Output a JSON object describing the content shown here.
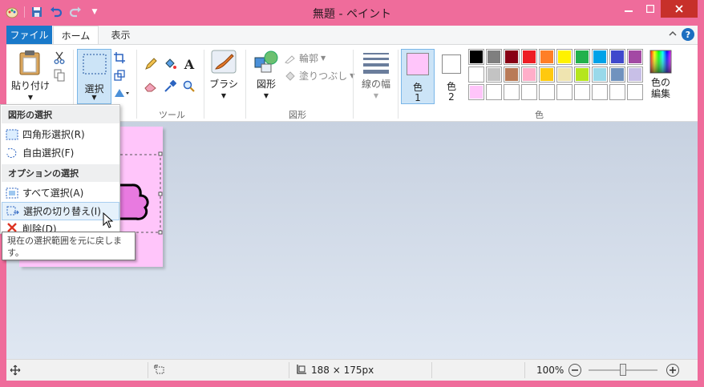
{
  "window": {
    "title": "無題 - ペイント"
  },
  "tabs": {
    "file": "ファイル",
    "home": "ホーム",
    "view": "表示"
  },
  "ribbon": {
    "clipboard": {
      "paste_label": "貼り付け"
    },
    "image": {
      "select_label": "選択"
    },
    "tools": {
      "group_label": "ツール"
    },
    "brushes": {
      "label": "ブラシ"
    },
    "shapes": {
      "shapes_label": "図形",
      "outline_label": "輪郭",
      "fill_label": "塗りつぶし",
      "group_label": "図形"
    },
    "size": {
      "label": "線の幅"
    },
    "colors": {
      "color1_label": "色",
      "color1_num": "1",
      "color2_label": "色",
      "color2_num": "2",
      "edit_label_1": "色の",
      "edit_label_2": "編集",
      "group_label": "色",
      "color1": "#ffc5fa",
      "color2": "#ffffff",
      "palette_row1": [
        "#000000",
        "#7f7f7f",
        "#880015",
        "#ed1c24",
        "#ff7f27",
        "#fff200",
        "#22b14c",
        "#00a2e8",
        "#3f48cc",
        "#a349a4"
      ],
      "palette_row2": [
        "#ffffff",
        "#c3c3c3",
        "#b97a57",
        "#ffaec9",
        "#ffc90e",
        "#efe4b0",
        "#b5e61d",
        "#99d9ea",
        "#7092be",
        "#c8bfe7"
      ],
      "palette_row3": [
        "#ffc5fa",
        "#ffffff",
        "#ffffff",
        "#ffffff",
        "#ffffff",
        "#ffffff",
        "#ffffff",
        "#ffffff",
        "#ffffff",
        "#ffffff"
      ]
    }
  },
  "menu": {
    "heading_shape": "図形の選択",
    "rect_select": "四角形選択(R)",
    "free_select": "自由選択(F)",
    "heading_options": "オプションの選択",
    "select_all": "すべて選択(A)",
    "invert_select": "選択の切り替え(I)",
    "delete": "削除(D)"
  },
  "tooltip": {
    "text": "現在の選択範囲を元に戻します。"
  },
  "statusbar": {
    "size": "188 × 175px",
    "zoom": "100%",
    "zoom_level": 0.5
  }
}
